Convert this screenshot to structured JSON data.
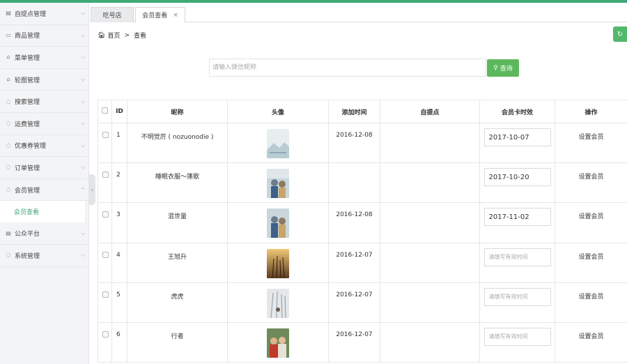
{
  "sidebar": {
    "items": [
      {
        "label": "自提点管理",
        "icon": "grid-icon"
      },
      {
        "label": "商品管理",
        "icon": "card-icon"
      },
      {
        "label": "菜单管理",
        "icon": "bag-icon"
      },
      {
        "label": "轮图管理",
        "icon": "bag-icon"
      },
      {
        "label": "搜索管理",
        "icon": "circle-icon"
      },
      {
        "label": "运费管理",
        "icon": "circle-icon"
      },
      {
        "label": "优惠券管理",
        "icon": "circle-icon"
      },
      {
        "label": "订单管理",
        "icon": "circle-icon"
      },
      {
        "label": "会员管理",
        "icon": "circle-icon"
      },
      {
        "label": "公众平台",
        "icon": "grid-icon"
      },
      {
        "label": "系统管理",
        "icon": "circle-icon"
      }
    ],
    "active_sub": "会员查看"
  },
  "tabs": [
    {
      "label": "吃号店"
    },
    {
      "label": "会员查看",
      "close": "×"
    }
  ],
  "breadcrumb": {
    "home": "首页",
    "separator": ">",
    "current": "查看"
  },
  "search": {
    "placeholder": "请输入微信昵称",
    "button_label": "查询"
  },
  "table": {
    "headers": [
      "",
      "ID",
      "昵称",
      "头像",
      "添加时间",
      "自提点",
      "会员卡时效",
      "操作"
    ],
    "date_placeholder": "请填写有效时间",
    "rows": [
      {
        "id": "1",
        "nickname": "不明觉厉 ( nozuonodie )",
        "added": "2016-12-08",
        "pickup": "",
        "expiry": "2017-10-07",
        "action": "设置会员"
      },
      {
        "id": "2",
        "nickname": "睡眠衣服～蓮歌",
        "added": "",
        "pickup": "",
        "expiry": "2017-10-20",
        "action": "设置会员"
      },
      {
        "id": "3",
        "nickname": "混世量",
        "added": "2016-12-08",
        "pickup": "",
        "expiry": "2017-11-02",
        "action": "设置会员"
      },
      {
        "id": "4",
        "nickname": "王旭升",
        "added": "2016-12-07",
        "pickup": "",
        "expiry": "",
        "action": "设置会员"
      },
      {
        "id": "5",
        "nickname": "虎虎",
        "added": "2016-12-07",
        "pickup": "",
        "expiry": "",
        "action": "设置会员"
      },
      {
        "id": "6",
        "nickname": "行者",
        "added": "2016-12-07",
        "pickup": "",
        "expiry": "",
        "action": "设置会员"
      }
    ]
  },
  "colors": {
    "accent": "#3fa977",
    "button": "#5cb85c"
  }
}
